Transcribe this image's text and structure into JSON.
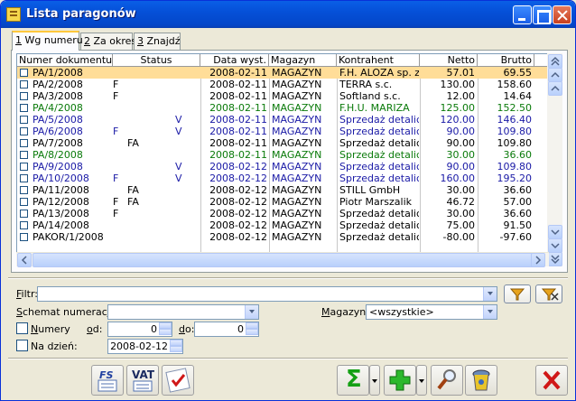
{
  "window": {
    "title": "Lista paragonów"
  },
  "tabs": [
    {
      "key": "1",
      "label": " Wg numeru"
    },
    {
      "key": "2",
      "label": " Za okres"
    },
    {
      "key": "3",
      "label": " Znajdź"
    }
  ],
  "columns": [
    "Numer dokumentu",
    "Status",
    "Data wyst.",
    "Magazyn",
    "Kontrahent",
    "Netto",
    "Brutto"
  ],
  "rows": [
    {
      "numer": "PA/1/2008",
      "s1": "",
      "s2": "",
      "s3": "",
      "data": "2008-02-11",
      "magazyn": "MAGAZYN",
      "kontrahent": "F.H. ALOZA sp. z",
      "netto": "57.01",
      "brutto": "69.55",
      "color": "black",
      "selected": true
    },
    {
      "numer": "PA/2/2008",
      "s1": "F",
      "s2": "",
      "s3": "",
      "data": "2008-02-11",
      "magazyn": "MAGAZYN",
      "kontrahent": "TERRA s.c.",
      "netto": "130.00",
      "brutto": "158.60",
      "color": "black"
    },
    {
      "numer": "PA/3/2008",
      "s1": "F",
      "s2": "",
      "s3": "",
      "data": "2008-02-11",
      "magazyn": "MAGAZYN",
      "kontrahent": "Softland s.c.",
      "netto": "12.00",
      "brutto": "14.64",
      "color": "black"
    },
    {
      "numer": "PA/4/2008",
      "s1": "",
      "s2": "",
      "s3": "",
      "data": "2008-02-11",
      "magazyn": "MAGAZYN",
      "kontrahent": "F.H.U. MARIZA",
      "netto": "125.00",
      "brutto": "152.50",
      "color": "green"
    },
    {
      "numer": "PA/5/2008",
      "s1": "",
      "s2": "",
      "s3": "V",
      "data": "2008-02-11",
      "magazyn": "MAGAZYN",
      "kontrahent": "Sprzedaż detaliczn",
      "netto": "120.00",
      "brutto": "146.40",
      "color": "blue"
    },
    {
      "numer": "PA/6/2008",
      "s1": "F",
      "s2": "",
      "s3": "V",
      "data": "2008-02-11",
      "magazyn": "MAGAZYN",
      "kontrahent": "Sprzedaż detaliczn",
      "netto": "90.00",
      "brutto": "109.80",
      "color": "blue"
    },
    {
      "numer": "PA/7/2008",
      "s1": "",
      "s2": "FA",
      "s3": "",
      "data": "2008-02-11",
      "magazyn": "MAGAZYN",
      "kontrahent": "Sprzedaż detaliczn",
      "netto": "90.00",
      "brutto": "109.80",
      "color": "black"
    },
    {
      "numer": "PA/8/2008",
      "s1": "",
      "s2": "",
      "s3": "",
      "data": "2008-02-11",
      "magazyn": "MAGAZYN",
      "kontrahent": "Sprzedaż detaliczn",
      "netto": "30.00",
      "brutto": "36.60",
      "color": "green"
    },
    {
      "numer": "PA/9/2008",
      "s1": "",
      "s2": "",
      "s3": "V",
      "data": "2008-02-12",
      "magazyn": "MAGAZYN",
      "kontrahent": "Sprzedaż detaliczn",
      "netto": "90.00",
      "brutto": "109.80",
      "color": "blue"
    },
    {
      "numer": "PA/10/2008",
      "s1": "F",
      "s2": "",
      "s3": "V",
      "data": "2008-02-12",
      "magazyn": "MAGAZYN",
      "kontrahent": "Sprzedaż detaliczn",
      "netto": "160.00",
      "brutto": "195.20",
      "color": "blue"
    },
    {
      "numer": "PA/11/2008",
      "s1": "",
      "s2": "FA",
      "s3": "",
      "data": "2008-02-12",
      "magazyn": "MAGAZYN",
      "kontrahent": "STILL GmbH",
      "netto": "30.00",
      "brutto": "36.60",
      "color": "black"
    },
    {
      "numer": "PA/12/2008",
      "s1": "F",
      "s2": "FA",
      "s3": "",
      "data": "2008-02-12",
      "magazyn": "MAGAZYN",
      "kontrahent": "Piotr Marszalik",
      "netto": "46.72",
      "brutto": "57.00",
      "color": "black"
    },
    {
      "numer": "PA/13/2008",
      "s1": "F",
      "s2": "",
      "s3": "",
      "data": "2008-02-12",
      "magazyn": "MAGAZYN",
      "kontrahent": "Sprzedaż detaliczn",
      "netto": "30.00",
      "brutto": "36.60",
      "color": "black"
    },
    {
      "numer": "PA/14/2008",
      "s1": "",
      "s2": "",
      "s3": "",
      "data": "2008-02-12",
      "magazyn": "MAGAZYN",
      "kontrahent": "Sprzedaż detaliczn",
      "netto": "75.00",
      "brutto": "91.50",
      "color": "black"
    },
    {
      "numer": "PAKOR/1/2008",
      "s1": "",
      "s2": "",
      "s3": "",
      "data": "2008-02-12",
      "magazyn": "MAGAZYN",
      "kontrahent": "Sprzedaż detaliczn",
      "netto": "-80.00",
      "brutto": "-97.60",
      "color": "black"
    }
  ],
  "filters": {
    "filtr_key": "F",
    "filtr_label": "iltr:",
    "filtr_value": "",
    "schemat_key": "S",
    "schemat_label": "chemat numeracji:",
    "schemat_value": "",
    "magazyn_key": "M",
    "magazyn_label": "agazyn:",
    "magazyn_value": "<wszystkie>",
    "numery_key": "N",
    "numery_label": "umery",
    "od_key": "o",
    "od_label": "d:",
    "od_value": "0",
    "do_key": "d",
    "do_label": "o:",
    "do_value": "0",
    "na_dzien_label": "Na dzień:",
    "na_dzien_value": "2008-02-12"
  },
  "toolbar": {
    "fs_label": "FS",
    "vat_label": "VAT",
    "sum_label": "Σ"
  },
  "colors": {
    "accent": "#0A5FE6",
    "selected_row": "#FFDD98",
    "blue_text": "#1A1AA6",
    "green_text": "#0A7A0A"
  }
}
